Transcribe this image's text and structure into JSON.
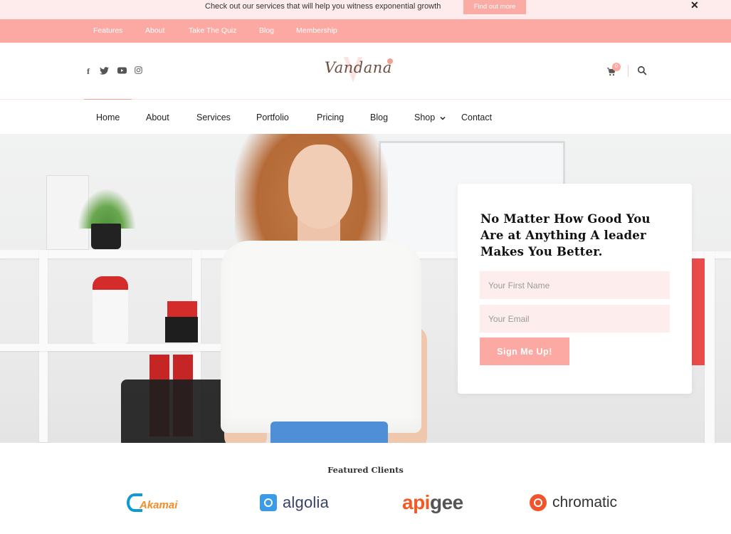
{
  "announcement": {
    "text": "Check out our services that will help you witness exponential growth",
    "button_label": "Find out more",
    "close_label": "x"
  },
  "top_nav": {
    "items": [
      {
        "label": "Features"
      },
      {
        "label": "About"
      },
      {
        "label": "Take The Quiz"
      },
      {
        "label": "Blog"
      },
      {
        "label": "Membership"
      }
    ]
  },
  "header": {
    "social_icons": [
      "facebook-icon",
      "twitter-icon",
      "youtube-icon",
      "instagram-icon"
    ],
    "logo_text": "Vandana",
    "cart_count": "0"
  },
  "main_nav": {
    "items": [
      {
        "label": "Home",
        "active": true
      },
      {
        "label": "About"
      },
      {
        "label": "Services"
      },
      {
        "label": "Portfolio"
      },
      {
        "label": "Pricing"
      },
      {
        "label": "Blog"
      },
      {
        "label": "Shop",
        "has_dropdown": true
      },
      {
        "label": "Contact"
      }
    ],
    "dropdown_glyph": "⌄"
  },
  "hero": {
    "card": {
      "title": "No Matter How Good You Are at Anything A leader Makes You Better.",
      "first_name_placeholder": "Your First Name",
      "email_placeholder": "Your Email",
      "button_label": "Sign Me Up!"
    }
  },
  "clients": {
    "title": "Featured Clients",
    "logos": [
      {
        "name": "Akamai"
      },
      {
        "name": "algolia"
      },
      {
        "name_part1": "api",
        "name_part2": "gee"
      },
      {
        "name": "chromatic"
      }
    ]
  },
  "colors": {
    "accent": "#fba9a2",
    "announcement_bg": "#fdeceb",
    "input_bg": "#fdeeed"
  }
}
